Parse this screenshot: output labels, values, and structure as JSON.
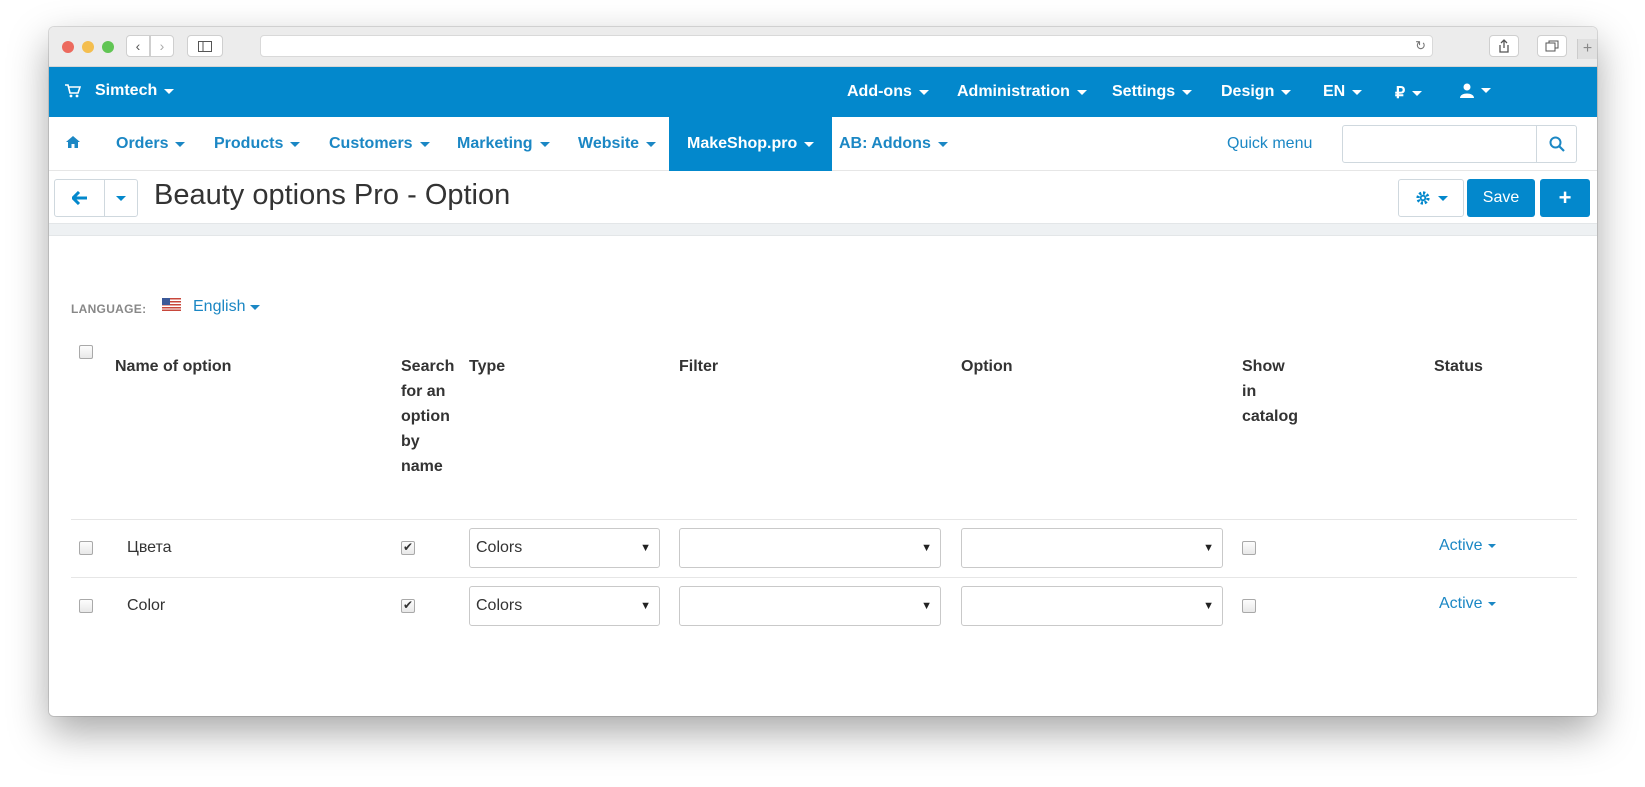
{
  "topbar": {
    "brand": "Simtech",
    "items": [
      "Add-ons",
      "Administration",
      "Settings",
      "Design",
      "EN",
      "₽"
    ]
  },
  "menu": {
    "items": [
      "Orders",
      "Products",
      "Customers",
      "Marketing",
      "Website",
      "MakeShop.pro",
      "AB: Addons"
    ],
    "active": "MakeShop.pro",
    "quick_menu": "Quick menu",
    "search_placeholder": ""
  },
  "page": {
    "title": "Beauty options Pro - Option",
    "save_label": "Save"
  },
  "language": {
    "label": "LANGUAGE:",
    "value": "English"
  },
  "table": {
    "headers": {
      "name": "Name of option",
      "search_lines": [
        "Search",
        "for an",
        "option",
        "by",
        "name"
      ],
      "type": "Type",
      "filter": "Filter",
      "option": "Option",
      "show_lines": [
        "Show",
        "in",
        "catalog"
      ],
      "status": "Status"
    },
    "rows": [
      {
        "name": "Цвета",
        "search": true,
        "type": "Colors",
        "filter": "",
        "option": "",
        "show_in_catalog": false,
        "status": "Active"
      },
      {
        "name": "Color",
        "search": true,
        "type": "Colors",
        "filter": "",
        "option": "",
        "show_in_catalog": false,
        "status": "Active"
      }
    ]
  },
  "colors": {
    "primary": "#0388cc",
    "link": "#1b87c4"
  }
}
